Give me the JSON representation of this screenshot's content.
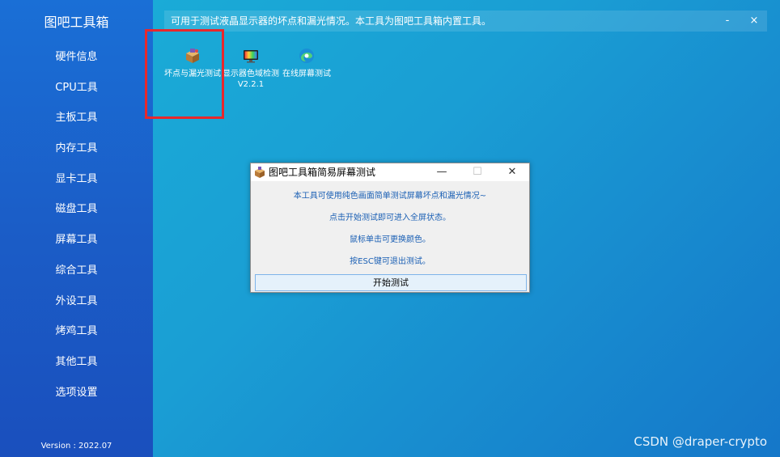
{
  "app": {
    "title": "图吧工具箱",
    "version": "Version : 2022.07"
  },
  "sidebar": {
    "items": [
      {
        "label": "硬件信息"
      },
      {
        "label": "CPU工具"
      },
      {
        "label": "主板工具"
      },
      {
        "label": "内存工具"
      },
      {
        "label": "显卡工具"
      },
      {
        "label": "磁盘工具"
      },
      {
        "label": "屏幕工具"
      },
      {
        "label": "综合工具"
      },
      {
        "label": "外设工具"
      },
      {
        "label": "烤鸡工具"
      },
      {
        "label": "其他工具"
      },
      {
        "label": "选项设置"
      }
    ]
  },
  "topbar": {
    "description": "可用于测试液晶显示器的坏点和漏光情况。本工具为图吧工具箱内置工具。",
    "minimize": "-",
    "close": "×"
  },
  "tools": [
    {
      "label": "坏点与漏光测试",
      "icon": "box-icon"
    },
    {
      "label": "显示器色域检测V2.2.1",
      "icon": "monitor-icon"
    },
    {
      "label": "在线屏幕测试",
      "icon": "edge-browser-icon"
    }
  ],
  "dialog": {
    "title": "图吧工具箱简易屏幕测试",
    "minimize": "—",
    "maximize": "☐",
    "close": "✕",
    "lines": [
      "本工具可使用纯色画面简单测试屏幕坏点和漏光情况~",
      "点击开始测试即可进入全屏状态。",
      "鼠标单击可更换颜色。",
      "按ESC键可退出测试。"
    ],
    "start_button": "开始测试"
  },
  "watermark": "CSDN @draper-crypto",
  "colors": {
    "highlight": "#e8282c",
    "dialog_text": "#1a5fb4"
  }
}
